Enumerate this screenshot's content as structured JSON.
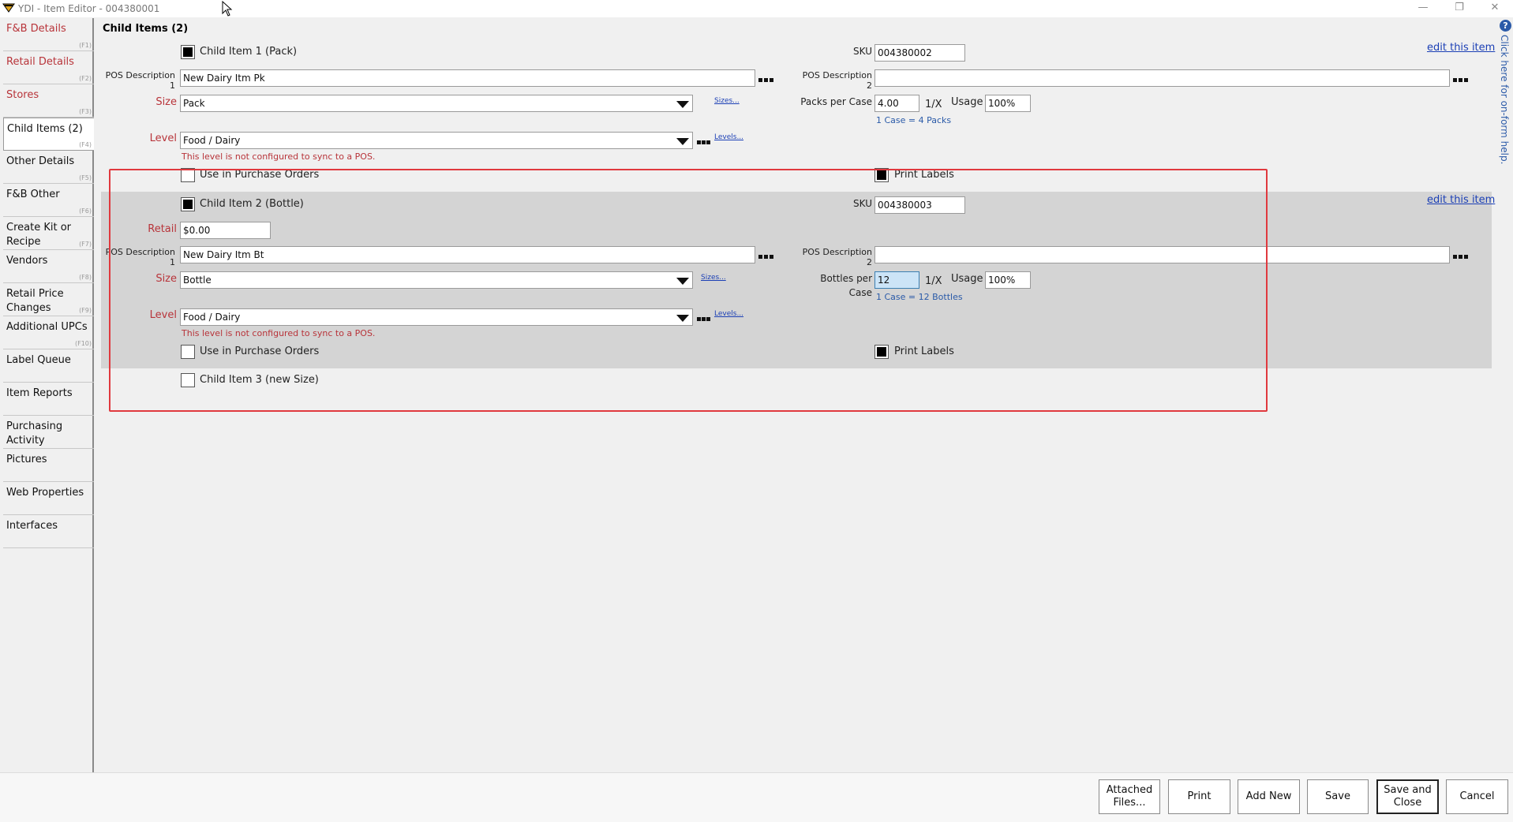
{
  "window": {
    "title": "YDI - Item Editor - 004380001",
    "minimize": "—",
    "restore": "❐",
    "close": "✕"
  },
  "sidebar": {
    "items": [
      {
        "label": "F&B Details",
        "key": "(F1)",
        "color": "red"
      },
      {
        "label": "Retail Details",
        "key": "(F2)",
        "color": "red"
      },
      {
        "label": "Stores",
        "key": "(F3)",
        "color": "red"
      },
      {
        "label": "Child Items (2)",
        "key": "(F4)",
        "color": "black"
      },
      {
        "label": "Other Details",
        "key": "(F5)",
        "color": "black"
      },
      {
        "label": "F&B Other",
        "key": "(F6)",
        "color": "black"
      },
      {
        "label": "Create Kit or Recipe",
        "key": "(F7)",
        "color": "black"
      },
      {
        "label": "Vendors",
        "key": "(F8)",
        "color": "black"
      },
      {
        "label": "Retail Price Changes",
        "key": "(F9)",
        "color": "black"
      },
      {
        "label": "Additional UPCs",
        "key": "(F10)",
        "color": "black"
      },
      {
        "label": "Label Queue",
        "key": "",
        "color": "black"
      },
      {
        "label": "Item Reports",
        "key": "",
        "color": "black"
      },
      {
        "label": "Purchasing Activity",
        "key": "",
        "color": "black"
      },
      {
        "label": "Pictures",
        "key": "",
        "color": "black"
      },
      {
        "label": "Web Properties",
        "key": "",
        "color": "black"
      },
      {
        "label": "Interfaces",
        "key": "",
        "color": "black"
      }
    ]
  },
  "main": {
    "section_title": "Child Items (2)",
    "child1": {
      "checkbox_label": "Child Item 1 (Pack)",
      "checked": true,
      "sku_label": "SKU",
      "sku": "004380002",
      "edit_link": "edit this item",
      "pos_desc1_label": "POS Description 1",
      "pos_desc1": "New Dairy Itm Pk",
      "pos_desc2_label": "POS Description 2",
      "pos_desc2": "",
      "size_label": "Size",
      "size": "Pack",
      "sizes_link": "Sizes...",
      "per_case_label": "Packs per Case",
      "per_case": "4.00",
      "per_x": "1/X",
      "usage_label": "Usage",
      "usage": "100%",
      "case_info": "1 Case = 4 Packs",
      "level_label": "Level",
      "level": "Food / Dairy",
      "levels_link": "Levels...",
      "level_warning": "This level is not configured to sync to a POS.",
      "use_po_label": "Use in Purchase Orders",
      "print_labels_label": "Print Labels"
    },
    "child2": {
      "checkbox_label": "Child Item 2 (Bottle)",
      "checked": true,
      "sku_label": "SKU",
      "sku": "004380003",
      "edit_link": "edit this item",
      "retail_label": "Retail",
      "retail": "$0.00",
      "pos_desc1_label": "POS Description 1",
      "pos_desc1": "New Dairy Itm Bt",
      "pos_desc2_label": "POS Description 2",
      "pos_desc2": "",
      "size_label": "Size",
      "size": "Bottle",
      "sizes_link": "Sizes...",
      "per_case_label_line1": "Bottles per",
      "per_case_label_line2": "Case",
      "per_case": "12",
      "per_x": "1/X",
      "usage_label": "Usage",
      "usage": "100%",
      "case_info": "1 Case = 12 Bottles",
      "level_label": "Level",
      "level": "Food / Dairy",
      "levels_link": "Levels...",
      "level_warning": "This level is not configured to sync to a POS.",
      "use_po_label": "Use in Purchase Orders",
      "print_labels_label": "Print Labels"
    },
    "child3": {
      "checkbox_label": "Child Item 3 (new Size)",
      "checked": false
    }
  },
  "help_tab": {
    "icon": "?",
    "text": "Click here for on-form help."
  },
  "buttons": {
    "attached_files_line1": "Attached",
    "attached_files_line2": "Files...",
    "print": "Print",
    "add_new": "Add New",
    "save": "Save",
    "save_close_line1": "Save and",
    "save_close_line2": "Close",
    "cancel": "Cancel"
  },
  "colors": {
    "accent_red": "#b8343a",
    "link_blue": "#1b3fb5",
    "highlight_border": "#e0393e",
    "band_gray": "#d4d4d4"
  }
}
